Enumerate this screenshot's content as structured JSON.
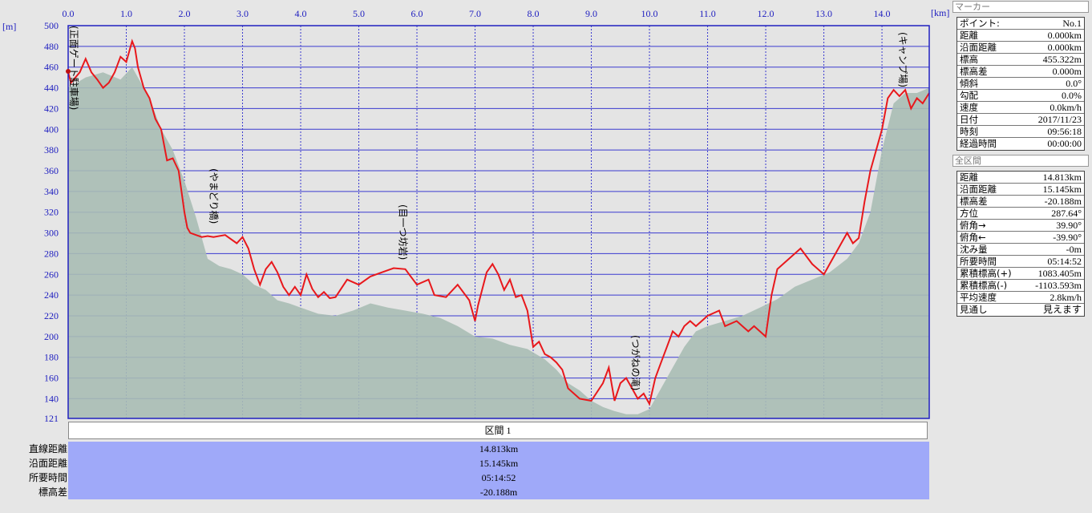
{
  "chart_data": {
    "type": "area",
    "x_unit": "[km]",
    "y_unit": "[m]",
    "x_ticks": [
      "0.0",
      "1.0",
      "2.0",
      "3.0",
      "4.0",
      "5.0",
      "6.0",
      "7.0",
      "8.0",
      "9.0",
      "10.0",
      "11.0",
      "12.0",
      "13.0",
      "14.0"
    ],
    "y_ticks": [
      "500",
      "480",
      "460",
      "440",
      "420",
      "400",
      "380",
      "360",
      "340",
      "320",
      "300",
      "280",
      "260",
      "240",
      "220",
      "200",
      "180",
      "160",
      "140",
      "121"
    ],
    "xlim": [
      0,
      14.813
    ],
    "ylim": [
      121,
      500
    ],
    "grid": true,
    "series": [
      {
        "color": "#e8181c",
        "x": [
          0,
          0.05,
          0.2,
          0.3,
          0.4,
          0.5,
          0.6,
          0.7,
          0.8,
          0.9,
          1.0,
          1.1,
          1.15,
          1.2,
          1.3,
          1.4,
          1.5,
          1.6,
          1.7,
          1.8,
          1.9,
          2.0,
          2.05,
          2.1,
          2.2,
          2.3,
          2.4,
          2.5,
          2.7,
          2.9,
          3.0,
          3.1,
          3.2,
          3.3,
          3.4,
          3.5,
          3.6,
          3.7,
          3.8,
          3.9,
          4.0,
          4.1,
          4.2,
          4.3,
          4.4,
          4.5,
          4.6,
          4.8,
          5.0,
          5.2,
          5.4,
          5.6,
          5.8,
          6.0,
          6.2,
          6.3,
          6.5,
          6.7,
          6.9,
          7.0,
          7.05,
          7.2,
          7.3,
          7.4,
          7.5,
          7.6,
          7.7,
          7.8,
          7.9,
          8.0,
          8.1,
          8.2,
          8.3,
          8.4,
          8.5,
          8.6,
          8.8,
          9.0,
          9.2,
          9.3,
          9.4,
          9.5,
          9.6,
          9.7,
          9.8,
          9.9,
          10.0,
          10.1,
          10.2,
          10.3,
          10.4,
          10.5,
          10.6,
          10.7,
          10.8,
          11.0,
          11.2,
          11.3,
          11.5,
          11.7,
          11.8,
          11.9,
          12.0,
          12.1,
          12.2,
          12.4,
          12.6,
          12.8,
          13.0,
          13.1,
          13.2,
          13.3,
          13.4,
          13.5,
          13.6,
          13.7,
          13.8,
          14.0,
          14.1,
          14.2,
          14.3,
          14.4,
          14.5,
          14.6,
          14.7,
          14.813
        ],
        "values": [
          455,
          445,
          455,
          468,
          455,
          448,
          440,
          445,
          455,
          470,
          465,
          485,
          478,
          460,
          440,
          430,
          410,
          400,
          370,
          372,
          360,
          320,
          305,
          300,
          298,
          296,
          297,
          296,
          298,
          290,
          296,
          285,
          265,
          250,
          265,
          272,
          262,
          248,
          240,
          248,
          240,
          260,
          246,
          238,
          243,
          237,
          238,
          255,
          250,
          258,
          262,
          266,
          265,
          250,
          255,
          240,
          238,
          250,
          235,
          215,
          230,
          262,
          270,
          260,
          245,
          255,
          238,
          240,
          225,
          190,
          195,
          183,
          180,
          175,
          168,
          150,
          140,
          138,
          155,
          170,
          138,
          155,
          160,
          150,
          140,
          145,
          135,
          160,
          175,
          190,
          205,
          200,
          210,
          215,
          210,
          220,
          225,
          210,
          215,
          205,
          210,
          205,
          200,
          240,
          265,
          275,
          285,
          270,
          260,
          270,
          280,
          290,
          300,
          290,
          295,
          330,
          360,
          400,
          430,
          438,
          432,
          438,
          420,
          430,
          425,
          435
        ],
        "name": ""
      },
      {
        "color": "#a8bcb4",
        "x": [
          0,
          0.3,
          0.6,
          0.9,
          1.1,
          1.4,
          1.6,
          1.8,
          2.0,
          2.2,
          2.4,
          2.6,
          2.8,
          3.0,
          3.2,
          3.4,
          3.6,
          3.8,
          4.0,
          4.3,
          4.6,
          4.9,
          5.2,
          5.5,
          5.8,
          6.1,
          6.4,
          6.7,
          7.0,
          7.3,
          7.6,
          7.9,
          8.2,
          8.4,
          8.6,
          8.8,
          9.0,
          9.2,
          9.4,
          9.6,
          9.8,
          10.0,
          10.2,
          10.4,
          10.6,
          10.8,
          11.0,
          11.3,
          11.6,
          11.9,
          12.2,
          12.5,
          12.8,
          13.1,
          13.4,
          13.6,
          13.8,
          14.0,
          14.2,
          14.4,
          14.6,
          14.813
        ],
        "values": [
          440,
          450,
          455,
          448,
          460,
          430,
          400,
          380,
          350,
          315,
          275,
          268,
          265,
          260,
          250,
          245,
          235,
          232,
          228,
          222,
          220,
          225,
          232,
          228,
          225,
          222,
          218,
          210,
          200,
          198,
          192,
          188,
          178,
          168,
          155,
          148,
          138,
          132,
          128,
          125,
          125,
          130,
          150,
          170,
          190,
          205,
          210,
          215,
          220,
          228,
          236,
          248,
          255,
          262,
          275,
          290,
          320,
          380,
          425,
          435,
          435,
          440
        ],
        "name": ""
      }
    ],
    "annotations": [
      {
        "x": 0.0,
        "text": "(正面ゲート駐車場)"
      },
      {
        "x": 2.45,
        "text": "(やまどり橋)"
      },
      {
        "x": 5.7,
        "text": "(目一つ坊岩)"
      },
      {
        "x": 9.7,
        "text": "(つがねの滝)"
      },
      {
        "x": 14.3,
        "text": "(キャンプ場)"
      }
    ]
  },
  "summary": {
    "header": "区間 1",
    "rows": [
      {
        "label": "直線距離",
        "value": "14.813km"
      },
      {
        "label": "沿面距離",
        "value": "15.145km"
      },
      {
        "label": "所要時間",
        "value": "05:14:52"
      },
      {
        "label": "標高差",
        "value": "-20.188m"
      }
    ]
  },
  "sidebar": {
    "marker_title": "マーカー",
    "marker_rows": [
      {
        "k": "ポイント:",
        "v": "No.1"
      },
      {
        "k": "距離",
        "v": "0.000km"
      },
      {
        "k": "沿面距離",
        "v": "0.000km"
      },
      {
        "k": "標高",
        "v": "455.322m"
      },
      {
        "k": "標高差",
        "v": "0.000m"
      },
      {
        "k": "傾斜",
        "v": "0.0°"
      },
      {
        "k": "勾配",
        "v": "0.0%"
      },
      {
        "k": "速度",
        "v": "0.0km/h"
      },
      {
        "k": "日付",
        "v": "2017/11/23"
      },
      {
        "k": "時刻",
        "v": "09:56:18"
      },
      {
        "k": "経過時間",
        "v": "00:00:00"
      }
    ],
    "total_title": "全区間",
    "total_rows": [
      {
        "k": "距離",
        "v": "14.813km"
      },
      {
        "k": "沿面距離",
        "v": "15.145km"
      },
      {
        "k": "標高差",
        "v": "-20.188m"
      },
      {
        "k": "方位",
        "v": "287.64°"
      },
      {
        "k": "俯角→",
        "v": "39.90°"
      },
      {
        "k": "俯角←",
        "v": "-39.90°"
      },
      {
        "k": "沈み量",
        "v": "-0m"
      },
      {
        "k": "所要時間",
        "v": "05:14:52"
      },
      {
        "k": "累積標高(+)",
        "v": "1083.405m"
      },
      {
        "k": "累積標高(-)",
        "v": "-1103.593m"
      },
      {
        "k": "平均速度",
        "v": "2.8km/h"
      },
      {
        "k": "見通し",
        "v": "見えます"
      }
    ]
  }
}
